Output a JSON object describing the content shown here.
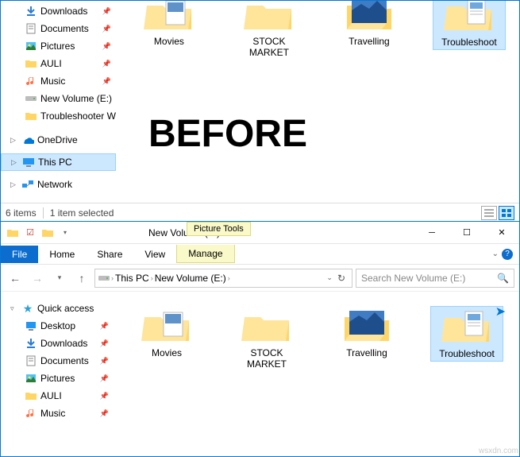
{
  "overlay_text": "BEFORE",
  "top_window": {
    "sidebar": {
      "downloads": "Downloads",
      "documents": "Documents",
      "pictures": "Pictures",
      "auli": "AULI",
      "music": "Music",
      "newvol": "New Volume (E:)",
      "trouble": "Troubleshooter W",
      "onedrive": "OneDrive",
      "thispc": "This PC",
      "network": "Network"
    },
    "folders": {
      "movies": "Movies",
      "stock": "STOCK MARKET",
      "travel": "Travelling",
      "troubleshoot": "Troubleshoot"
    },
    "status": {
      "items": "6 items",
      "selected": "1 item selected"
    }
  },
  "bottom_window": {
    "title": "New Volume (E:)",
    "ctx_title": "Picture Tools",
    "tabs": {
      "file": "File",
      "home": "Home",
      "share": "Share",
      "view": "View",
      "manage": "Manage"
    },
    "crumbs": {
      "pc": "This PC",
      "vol": "New Volume (E:)"
    },
    "search_placeholder": "Search New Volume (E:)",
    "sidebar": {
      "quick": "Quick access",
      "desktop": "Desktop",
      "downloads": "Downloads",
      "documents": "Documents",
      "pictures": "Pictures",
      "auli": "AULI",
      "music": "Music"
    },
    "folders": {
      "movies": "Movies",
      "stock": "STOCK MARKET",
      "travel": "Travelling",
      "troubleshoot": "Troubleshoot"
    }
  }
}
